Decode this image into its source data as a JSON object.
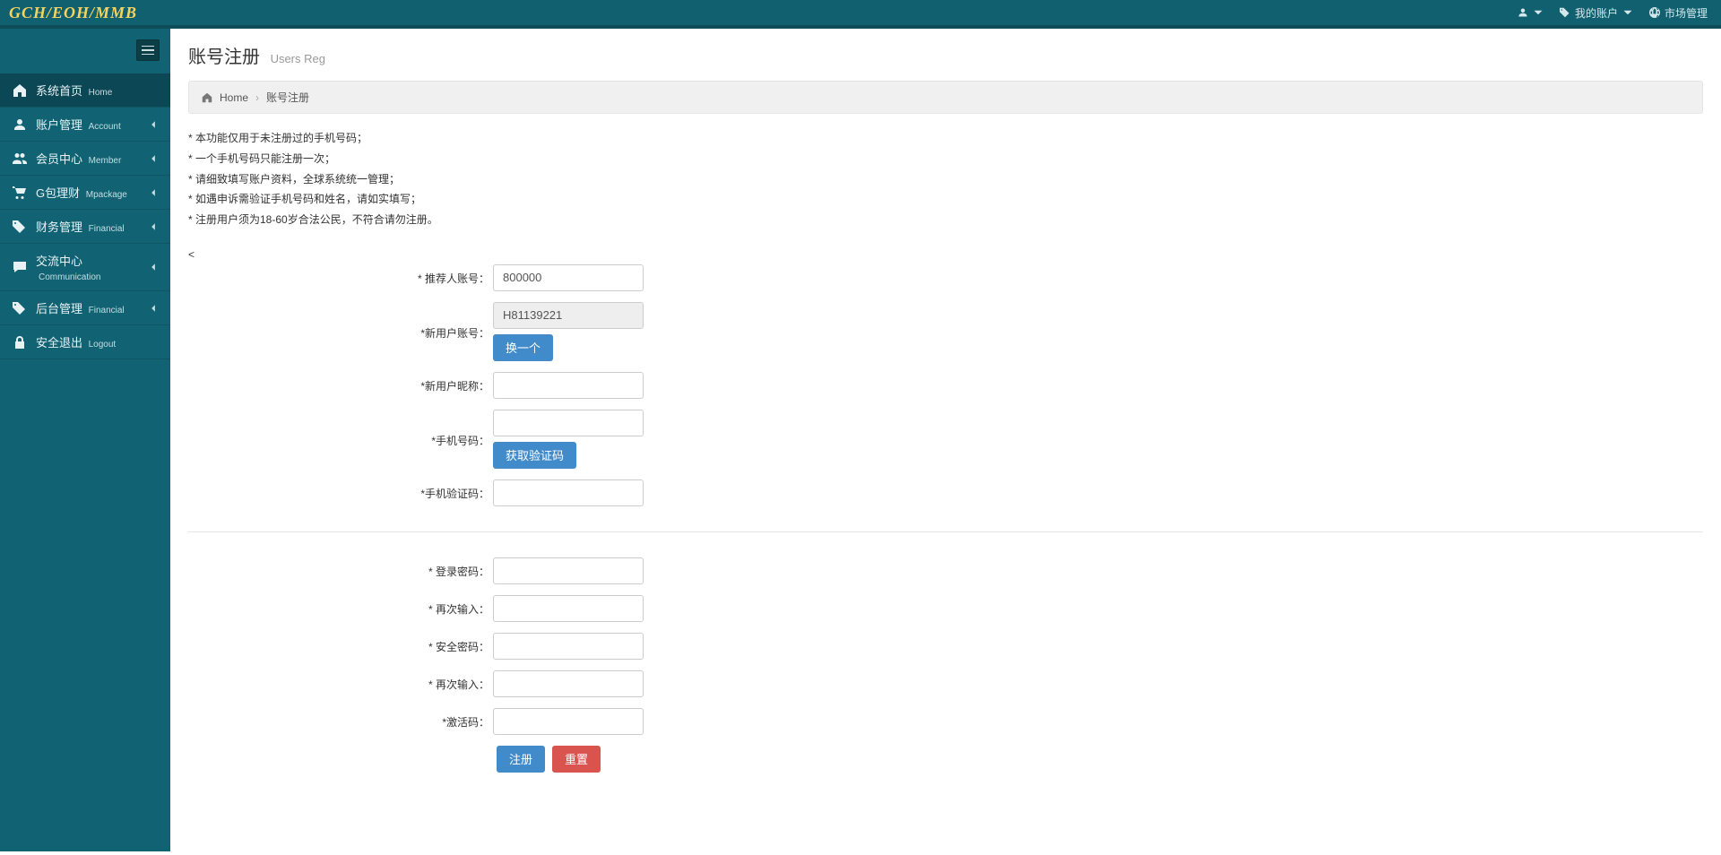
{
  "brand": "GCH/EOH/MMB",
  "topRight": {
    "myAccount": "我的账户",
    "marketMgmt": "市场管理"
  },
  "sidebar": [
    {
      "icon": "home",
      "label": "系统首页",
      "sub": "Home",
      "active": true,
      "expandable": false
    },
    {
      "icon": "user",
      "label": "账户管理",
      "sub": "Account",
      "active": false,
      "expandable": true
    },
    {
      "icon": "users",
      "label": "会员中心",
      "sub": "Member",
      "active": false,
      "expandable": true
    },
    {
      "icon": "cart",
      "label": "G包理财",
      "sub": "Mpackage",
      "active": false,
      "expandable": true
    },
    {
      "icon": "tags",
      "label": "财务管理",
      "sub": "Financial",
      "active": false,
      "expandable": true
    },
    {
      "icon": "chat",
      "label": "交流中心",
      "sub": "Communication",
      "active": false,
      "expandable": true
    },
    {
      "icon": "tags",
      "label": "后台管理",
      "sub": "Financial",
      "active": false,
      "expandable": true
    },
    {
      "icon": "lock",
      "label": "安全退出",
      "sub": "Logout",
      "active": false,
      "expandable": false
    }
  ],
  "page": {
    "title": "账号注册",
    "subtitle": "Users Reg"
  },
  "breadcrumb": {
    "home": "Home",
    "current": "账号注册"
  },
  "notes": [
    "* 本功能仅用于未注册过的手机号码；",
    "* 一个手机号码只能注册一次；",
    "* 请细致填写账户资料，全球系统统一管理；",
    "* 如遇申诉需验证手机号码和姓名，请如实填写；",
    "* 注册用户须为18-60岁合法公民，不符合请勿注册。"
  ],
  "stray": "<",
  "form": {
    "fields": {
      "referrer": {
        "label": "* 推荐人账号：",
        "value": "800000"
      },
      "newAccount": {
        "label": "*新用户账号：",
        "value": "H81139221",
        "changeBtn": "换一个"
      },
      "nickname": {
        "label": "*新用户昵称：",
        "value": ""
      },
      "phone": {
        "label": "*手机号码：",
        "value": "",
        "codeBtn": "获取验证码"
      },
      "phoneCode": {
        "label": "*手机验证码：",
        "value": ""
      },
      "loginPwd": {
        "label": "* 登录密码：",
        "value": ""
      },
      "loginPwd2": {
        "label": "* 再次输入：",
        "value": ""
      },
      "safePwd": {
        "label": "* 安全密码：",
        "value": ""
      },
      "safePwd2": {
        "label": "* 再次输入：",
        "value": ""
      },
      "activation": {
        "label": "*激活码：",
        "value": ""
      }
    },
    "actions": {
      "submit": "注册",
      "reset": "重置"
    }
  }
}
